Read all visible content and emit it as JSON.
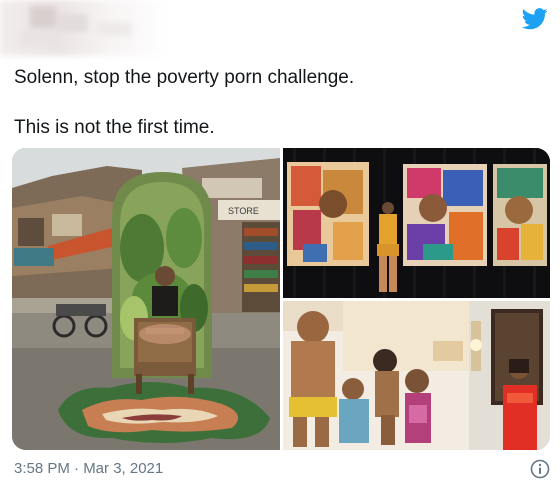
{
  "tweet": {
    "text_line1": "Solenn, stop the poverty porn challenge.",
    "text_line2": "This is not the first time.",
    "timestamp": "3:58 PM · Mar 3, 2021"
  },
  "media": {
    "photo1": {
      "sign_text": "STORE"
    }
  },
  "icons": {
    "brand": "twitter-bird-icon",
    "info": "info-icon"
  },
  "colors": {
    "twitter_blue": "#1da1f2",
    "text": "#14171a",
    "meta_text": "#657786"
  }
}
